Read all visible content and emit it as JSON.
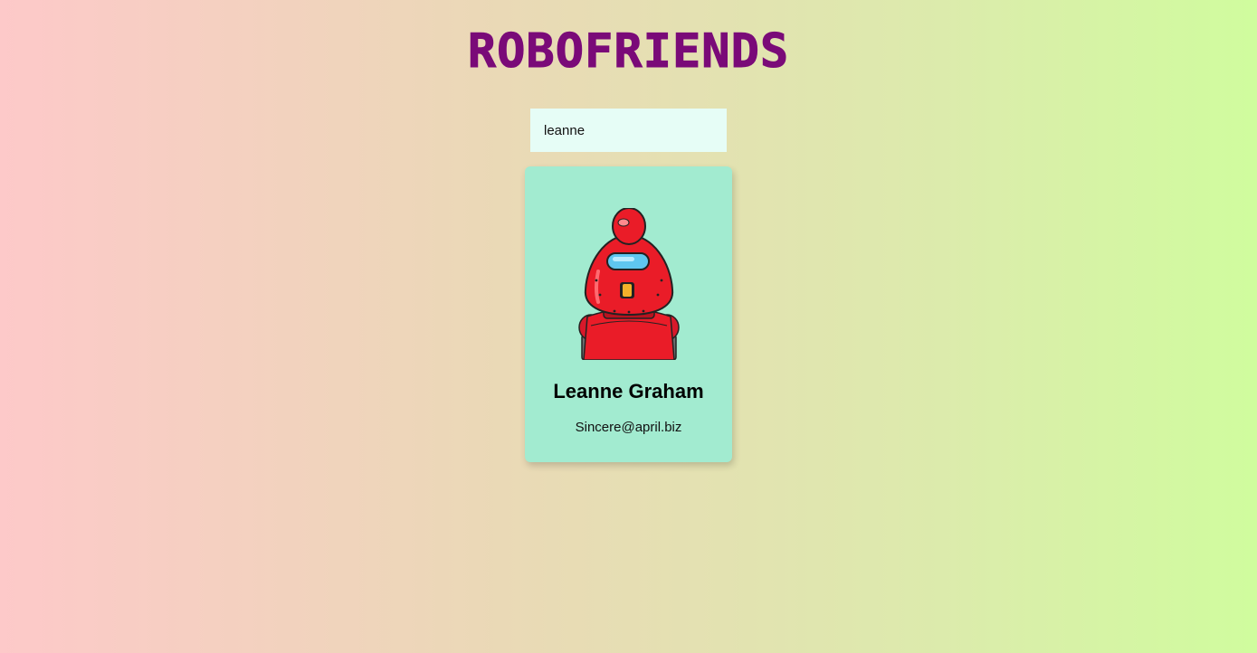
{
  "header": {
    "title": "ROBOFRIENDS"
  },
  "search": {
    "value": "leanne",
    "placeholder": "search robots"
  },
  "robots": [
    {
      "name": "Leanne Graham",
      "email": "Sincere@april.biz",
      "avatar_icon": "robot-avatar-icon"
    }
  ],
  "colors": {
    "title": "#7a0a78",
    "card": "#a2ebd0",
    "search_bg": "#e6fdf6",
    "gradient_left": "#fdc9c9",
    "gradient_right": "#d0fc9e"
  }
}
